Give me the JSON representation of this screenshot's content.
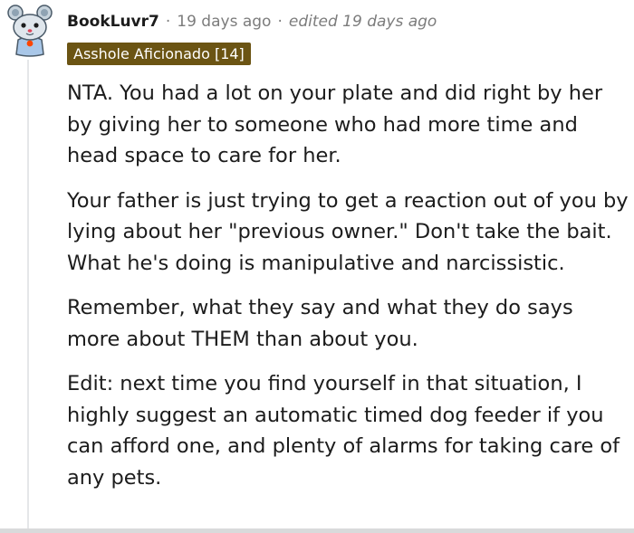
{
  "comment": {
    "username": "BookLuvr7",
    "separator": "·",
    "time_ago": "19 days ago",
    "edited": "edited 19 days ago",
    "flair": "Asshole Aficionado [14]",
    "paragraphs": [
      "NTA. You had a lot on your plate and did right by her by giving her to someone who had more time and head space to care for her.",
      "Your father is just trying to get a reaction out of you by lying about her \"previous owner.\" Don't take the bait. What he's doing is manipulative and narcissistic.",
      "Remember, what they say and what they do says more about THEM than about you.",
      "Edit: next time you find yourself in that situation, I highly suggest an automatic timed dog feeder if you can afford one, and plenty of alarms for taking care of any pets."
    ]
  },
  "icons": {
    "avatar": "snoo-avatar-icon"
  },
  "colors": {
    "flair_background": "#6b5413",
    "meta_text": "#7c7c7c",
    "body_text": "#1c1c1c"
  }
}
